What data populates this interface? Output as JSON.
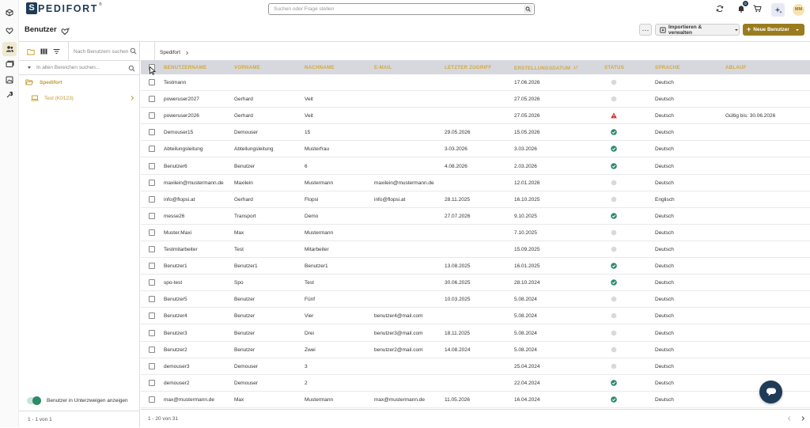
{
  "brand": {
    "logo_letter": "S",
    "logo_text": "PEDIFORT",
    "logo_reg": "®"
  },
  "header": {
    "search_placeholder": "Suchen oder Frage stellen",
    "notification_count": "0",
    "avatar_initials": "MM"
  },
  "rail": {
    "icons": [
      "box-icon",
      "heart-icon",
      "users-icon",
      "folders-icon",
      "image-icon",
      "tools-icon"
    ],
    "active": "users-icon"
  },
  "page": {
    "title": "Benutzer",
    "more_label": "···",
    "import_label": "Importieren & verwalten",
    "new_label": "Neue Benutzer"
  },
  "left_panel": {
    "user_search_placeholder": "Nach Benutzern suchen",
    "area_search_placeholder": "In allen Bereichen suchen...",
    "tree_root": "Spedifort",
    "tree_child": "Test (K0123)",
    "toggle_label": "Benutzer in Unterzweigen anzeigen",
    "toggle_on": true,
    "footer": "1 - 1 von 1"
  },
  "breadcrumb": {
    "item": "Spedifort"
  },
  "table": {
    "headers": {
      "username": "BENUTZERNAME",
      "firstname": "VORNAME",
      "lastname": "NACHNAME",
      "email": "E-MAIL",
      "last_access": "LETZTER ZUGRIFF",
      "created": "ERSTELLUNGSDATUM",
      "status": "STATUS",
      "language": "SPRACHE",
      "expiry": "ABLAUF"
    },
    "rows": [
      {
        "username": "Testmann",
        "firstname": "",
        "lastname": "",
        "email": "",
        "last_access": "",
        "created": "17.06.2026",
        "status": "inactive",
        "language": "Deutsch",
        "expiry": ""
      },
      {
        "username": "poweruser2027",
        "firstname": "Gerhard",
        "lastname": "Veit",
        "email": "",
        "last_access": "",
        "created": "27.05.2026",
        "status": "inactive",
        "language": "Deutsch",
        "expiry": ""
      },
      {
        "username": "poweruser2026",
        "firstname": "Gerhard",
        "lastname": "Veit",
        "email": "",
        "last_access": "",
        "created": "27.05.2026",
        "status": "warning",
        "language": "Deutsch",
        "expiry": "Gültig bis: 30.06.2026"
      },
      {
        "username": "Demouser15",
        "firstname": "Demouser",
        "lastname": "15",
        "email": "",
        "last_access": "29.05.2026",
        "created": "15.05.2026",
        "status": "active",
        "language": "Deutsch",
        "expiry": ""
      },
      {
        "username": "Abteilungsleitung",
        "firstname": "Abteilungsleitung",
        "lastname": "Musterfrau",
        "email": "",
        "last_access": "3.03.2026",
        "created": "3.03.2026",
        "status": "active",
        "language": "Deutsch",
        "expiry": ""
      },
      {
        "username": "Benutzer6",
        "firstname": "Benutzer",
        "lastname": "6",
        "email": "",
        "last_access": "4.08.2026",
        "created": "2.03.2026",
        "status": "active",
        "language": "Deutsch",
        "expiry": ""
      },
      {
        "username": "maxilein@mustermann.de",
        "firstname": "Maxilein",
        "lastname": "Mustermann",
        "email": "maxilein@mustermann.de",
        "last_access": "",
        "created": "12.01.2026",
        "status": "inactive",
        "language": "Deutsch",
        "expiry": ""
      },
      {
        "username": "info@flopsi.at",
        "firstname": "Gerhard",
        "lastname": "Flopsi",
        "email": "info@flopsi.at",
        "last_access": "28.11.2025",
        "created": "16.10.2025",
        "status": "inactive",
        "language": "Englisch",
        "expiry": ""
      },
      {
        "username": "messe26",
        "firstname": "Transport",
        "lastname": "Demo",
        "email": "",
        "last_access": "27.07.2026",
        "created": "9.10.2025",
        "status": "active",
        "language": "Deutsch",
        "expiry": ""
      },
      {
        "username": "Muster.Maxi",
        "firstname": "Max",
        "lastname": "Mustermann",
        "email": "",
        "last_access": "",
        "created": "7.10.2025",
        "status": "inactive",
        "language": "Deutsch",
        "expiry": ""
      },
      {
        "username": "Testmitarbeiter",
        "firstname": "Test",
        "lastname": "Mitarbeiter",
        "email": "",
        "last_access": "",
        "created": "15.09.2025",
        "status": "inactive",
        "language": "Deutsch",
        "expiry": ""
      },
      {
        "username": "Benutzer1",
        "firstname": "Benutzer1",
        "lastname": "Benutzer1",
        "email": "",
        "last_access": "13.08.2025",
        "created": "16.01.2025",
        "status": "active",
        "language": "Deutsch",
        "expiry": ""
      },
      {
        "username": "spo-test",
        "firstname": "Spo",
        "lastname": "Test",
        "email": "",
        "last_access": "30.06.2025",
        "created": "28.10.2024",
        "status": "active",
        "language": "Deutsch",
        "expiry": ""
      },
      {
        "username": "Benutzer5",
        "firstname": "Benutzer",
        "lastname": "Fünf",
        "email": "",
        "last_access": "10.03.2025",
        "created": "5.08.2024",
        "status": "inactive",
        "language": "Deutsch",
        "expiry": ""
      },
      {
        "username": "Benutzer4",
        "firstname": "Benutzer",
        "lastname": "Vier",
        "email": "benutzer4@mail.com",
        "last_access": "",
        "created": "5.08.2024",
        "status": "inactive",
        "language": "Deutsch",
        "expiry": ""
      },
      {
        "username": "Benutzer3",
        "firstname": "Benutzer",
        "lastname": "Drei",
        "email": "benutzer3@mail.com",
        "last_access": "18.11.2025",
        "created": "5.08.2024",
        "status": "inactive",
        "language": "Deutsch",
        "expiry": ""
      },
      {
        "username": "Benutzer2",
        "firstname": "Benutzer",
        "lastname": "Zwei",
        "email": "benutzer2@mail.com",
        "last_access": "14.08.2024",
        "created": "5.08.2024",
        "status": "inactive",
        "language": "Deutsch",
        "expiry": ""
      },
      {
        "username": "demouser3",
        "firstname": "Demouser",
        "lastname": "3",
        "email": "",
        "last_access": "",
        "created": "25.04.2024",
        "status": "inactive",
        "language": "Deutsch",
        "expiry": ""
      },
      {
        "username": "demouser2",
        "firstname": "Demouser",
        "lastname": "2",
        "email": "",
        "last_access": "",
        "created": "22.04.2024",
        "status": "active",
        "language": "Deutsch",
        "expiry": ""
      },
      {
        "username": "max@mustermann.de",
        "firstname": "Max",
        "lastname": "Mustermann",
        "email": "max@mustermann.de",
        "last_access": "11.05.2026",
        "created": "16.04.2024",
        "status": "active",
        "language": "Deutsch",
        "expiry": ""
      }
    ],
    "footer": "1 - 20 von 31"
  },
  "colors": {
    "brand": "#1f3b57",
    "accent": "#9a7c1f",
    "header_text": "#d4a93f",
    "active": "#2e8b67",
    "warning": "#d32f2f",
    "inactive": "#d9d9d9"
  }
}
